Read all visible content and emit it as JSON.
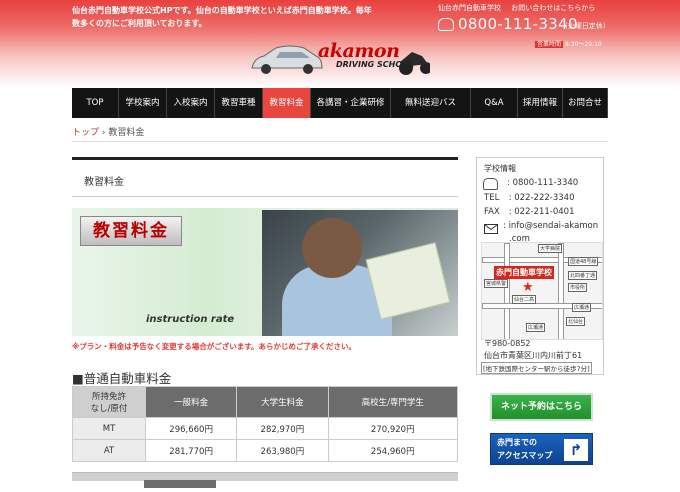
{
  "header": {
    "intro": "仙台赤門自動車学校公式HPです。仙台の自動車学校といえば赤門自動車学校。毎年数多くの方にご利用頂いております。",
    "links": [
      "仙台赤門自動車学校",
      "お問い合わせはこちらから"
    ],
    "phone": "0800-111-3340",
    "phone_note": "(火曜日定休)",
    "hours_label": "営業時間",
    "hours": "8:30〜20:10",
    "logo": "akamon",
    "logo_sub": "DRIVING SCHOOL"
  },
  "nav": [
    {
      "label": "TOP",
      "active": false
    },
    {
      "label": "学校案内",
      "active": false
    },
    {
      "label": "入校案内",
      "active": false
    },
    {
      "label": "教習車種",
      "active": false
    },
    {
      "label": "教習料金",
      "active": true
    },
    {
      "label": "各講習・企業研修",
      "active": false
    },
    {
      "label": "無料送迎バス",
      "active": false
    },
    {
      "label": "Q&A",
      "active": false
    },
    {
      "label": "採用情報",
      "active": false
    },
    {
      "label": "お問合せ",
      "active": false
    }
  ],
  "breadcrumb": {
    "home": "トップ",
    "sep": "›",
    "current": "教習料金"
  },
  "page_title": "教習料金",
  "banner": {
    "title": "教習料金",
    "subtitle": "instruction rate"
  },
  "notice": "※プラン・料金は予告なく変更する場合がございます。あらかじめご了承ください。",
  "section": {
    "title": "■普通自動車料金",
    "headers": [
      "所持免許\nなし/原付",
      "一般料金",
      "大学生料金",
      "高校生/専門学生"
    ],
    "rows": [
      [
        "MT",
        "296,660円",
        "282,970円",
        "270,920円"
      ],
      [
        "AT",
        "281,770円",
        "263,980円",
        "254,960円"
      ]
    ],
    "next_header": "所持免許"
  },
  "school_info": {
    "heading": "学校情報",
    "tel_free": ": 0800-111-3340",
    "tel_label": "TEL",
    "tel": ": 022-222-3340",
    "fax_label": "FAX",
    "fax": ": 022-211-0401",
    "email_line1": ": info@sendai-akamon",
    "email_line2": ".com",
    "map": {
      "title": "赤門自動車学校",
      "labels": [
        "大学病院",
        "宮城県警",
        "国道48号線",
        "北四番丁通",
        "市役所",
        "仙台二高",
        "広瀬通",
        "広瀬通",
        "北仙台"
      ]
    },
    "zip": "〒980-0852",
    "address": "仙台市青葉区川内川前丁61",
    "access": "[地下鉄国際センター駅から徒歩7分]"
  },
  "buttons": {
    "reserve": "ネット予約はこちら",
    "access_line1": "赤門までの",
    "access_line2": "アクセスマップ",
    "access_arrow": "↱"
  }
}
